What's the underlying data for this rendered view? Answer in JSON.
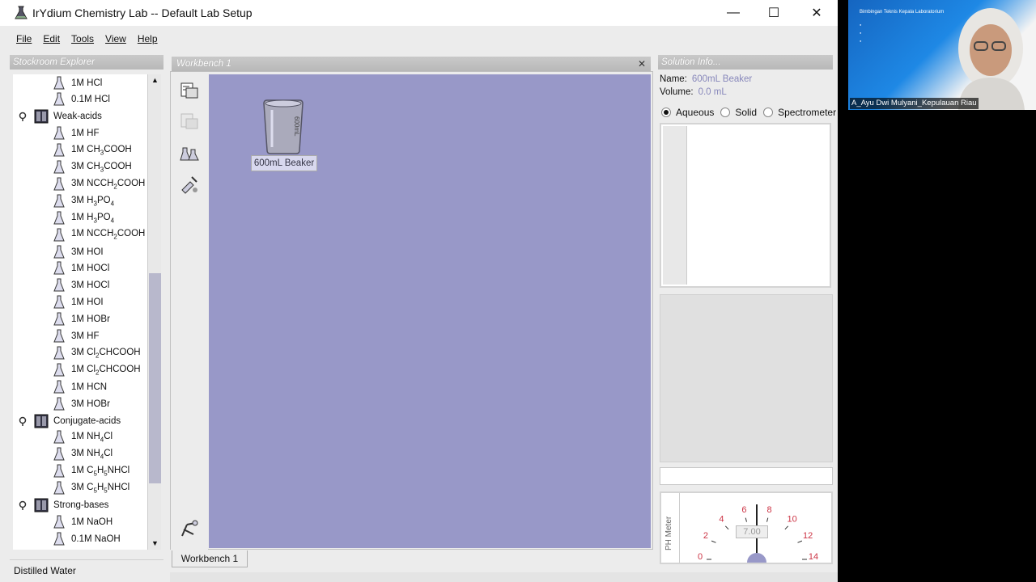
{
  "window": {
    "title": "IrYdium Chemistry Lab -- Default Lab Setup",
    "minimize": "—",
    "maximize": "☐",
    "close": "✕"
  },
  "menu": [
    "File",
    "Edit",
    "Tools",
    "View",
    "Help"
  ],
  "explorer": {
    "header": "Stockroom Explorer",
    "footer": "Distilled Water",
    "rows": [
      {
        "type": "item",
        "html": "1M HCl"
      },
      {
        "type": "item",
        "html": "0.1M HCl"
      },
      {
        "type": "cat",
        "html": "Weak-acids"
      },
      {
        "type": "item",
        "html": "1M HF"
      },
      {
        "type": "item",
        "html": "1M CH<sub>3</sub>COOH"
      },
      {
        "type": "item",
        "html": "3M CH<sub>3</sub>COOH"
      },
      {
        "type": "item",
        "html": "3M NCCH<sub>2</sub>COOH"
      },
      {
        "type": "item",
        "html": "3M H<sub>3</sub>PO<sub>4</sub>"
      },
      {
        "type": "item",
        "html": "1M H<sub>3</sub>PO<sub>4</sub>"
      },
      {
        "type": "item",
        "html": "1M NCCH<sub>2</sub>COOH"
      },
      {
        "type": "item",
        "html": "3M HOI"
      },
      {
        "type": "item",
        "html": "1M HOCl"
      },
      {
        "type": "item",
        "html": "3M HOCl"
      },
      {
        "type": "item",
        "html": "1M HOI"
      },
      {
        "type": "item",
        "html": "1M HOBr"
      },
      {
        "type": "item",
        "html": "3M HF"
      },
      {
        "type": "item",
        "html": "3M Cl<sub>2</sub>CHCOOH"
      },
      {
        "type": "item",
        "html": "1M Cl<sub>2</sub>CHCOOH"
      },
      {
        "type": "item",
        "html": "1M HCN"
      },
      {
        "type": "item",
        "html": "3M HOBr"
      },
      {
        "type": "cat",
        "html": "Conjugate-acids"
      },
      {
        "type": "item",
        "html": "1M NH<sub>4</sub>Cl"
      },
      {
        "type": "item",
        "html": "3M NH<sub>4</sub>Cl"
      },
      {
        "type": "item",
        "html": "1M C<sub>5</sub>H<sub>5</sub>NHCl"
      },
      {
        "type": "item",
        "html": "3M C<sub>5</sub>H<sub>5</sub>NHCl"
      },
      {
        "type": "cat",
        "html": "Strong-bases"
      },
      {
        "type": "item",
        "html": "1M NaOH"
      },
      {
        "type": "item",
        "html": "0.1M NaOH"
      }
    ]
  },
  "workbench": {
    "header": "Workbench 1",
    "close": "✕",
    "tab": "Workbench 1",
    "beaker_label": "600mL Beaker",
    "beaker_marking": "600mL"
  },
  "solution": {
    "header": "Solution Info...",
    "name_label": "Name:",
    "name_value": "600mL Beaker",
    "volume_label": "Volume:",
    "volume_value": "0.0 mL",
    "views": [
      "Aqueous",
      "Solid",
      "Spectrometer"
    ],
    "selected_view": "Aqueous"
  },
  "ph_meter": {
    "label": "PH Meter",
    "reading": "7.00",
    "scale": [
      "0",
      "2",
      "4",
      "6",
      "8",
      "10",
      "12",
      "14"
    ]
  },
  "video": {
    "slide_title": "Bimbingan Teknis Kepala Laboratorium",
    "participant": "A_Ayu Dwi Mulyani_Kepulauan Riau"
  },
  "colors": {
    "bench": "#9898c8",
    "scroll_thumb": "#b8b8cc",
    "ph_scale": "#cc3344"
  }
}
